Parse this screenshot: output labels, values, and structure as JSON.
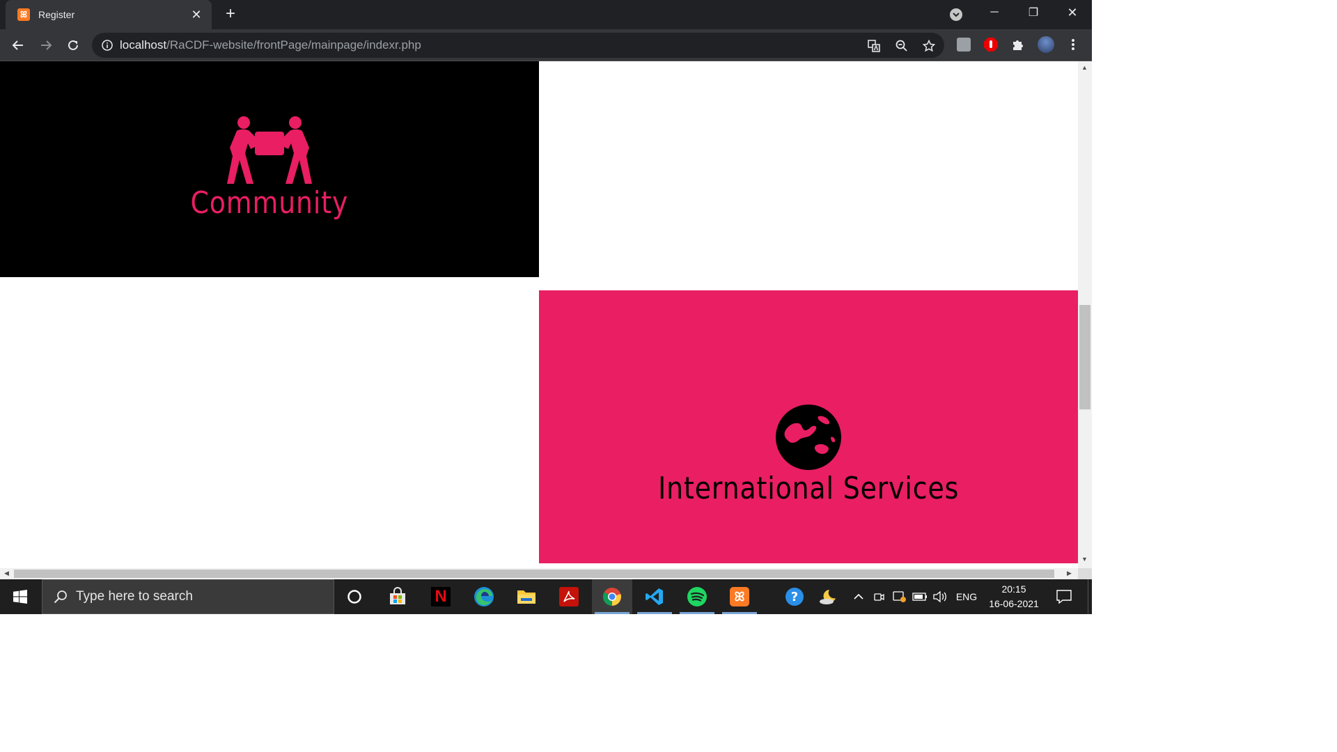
{
  "browser": {
    "tab": {
      "title": "Register",
      "favicon": "xampp-icon",
      "close": "✕"
    },
    "new_tab": "+",
    "url": {
      "host": "localhost",
      "path": "/RaCDF-website/frontPage/mainpage/indexr.php"
    },
    "window_controls": {
      "minimize": "─",
      "restore": "❐",
      "close": "✕"
    }
  },
  "page": {
    "community": {
      "title": "Community",
      "icon": "people-carry-icon",
      "bg": "#000000",
      "accent": "#e91e63"
    },
    "international": {
      "title": "International Services",
      "icon": "globe-icon",
      "bg": "#e91e63",
      "fg": "#000000"
    }
  },
  "taskbar": {
    "search_placeholder": "Type here to search",
    "apps": [
      "cortana-icon",
      "store-icon",
      "netflix-icon",
      "edge-icon",
      "file-explorer-icon",
      "acrobat-icon",
      "chrome-icon",
      "vscode-icon",
      "spotify-icon",
      "xampp-icon"
    ],
    "netflix_label": "N",
    "language": "ENG",
    "time": "20:15",
    "date": "16-06-2021"
  }
}
